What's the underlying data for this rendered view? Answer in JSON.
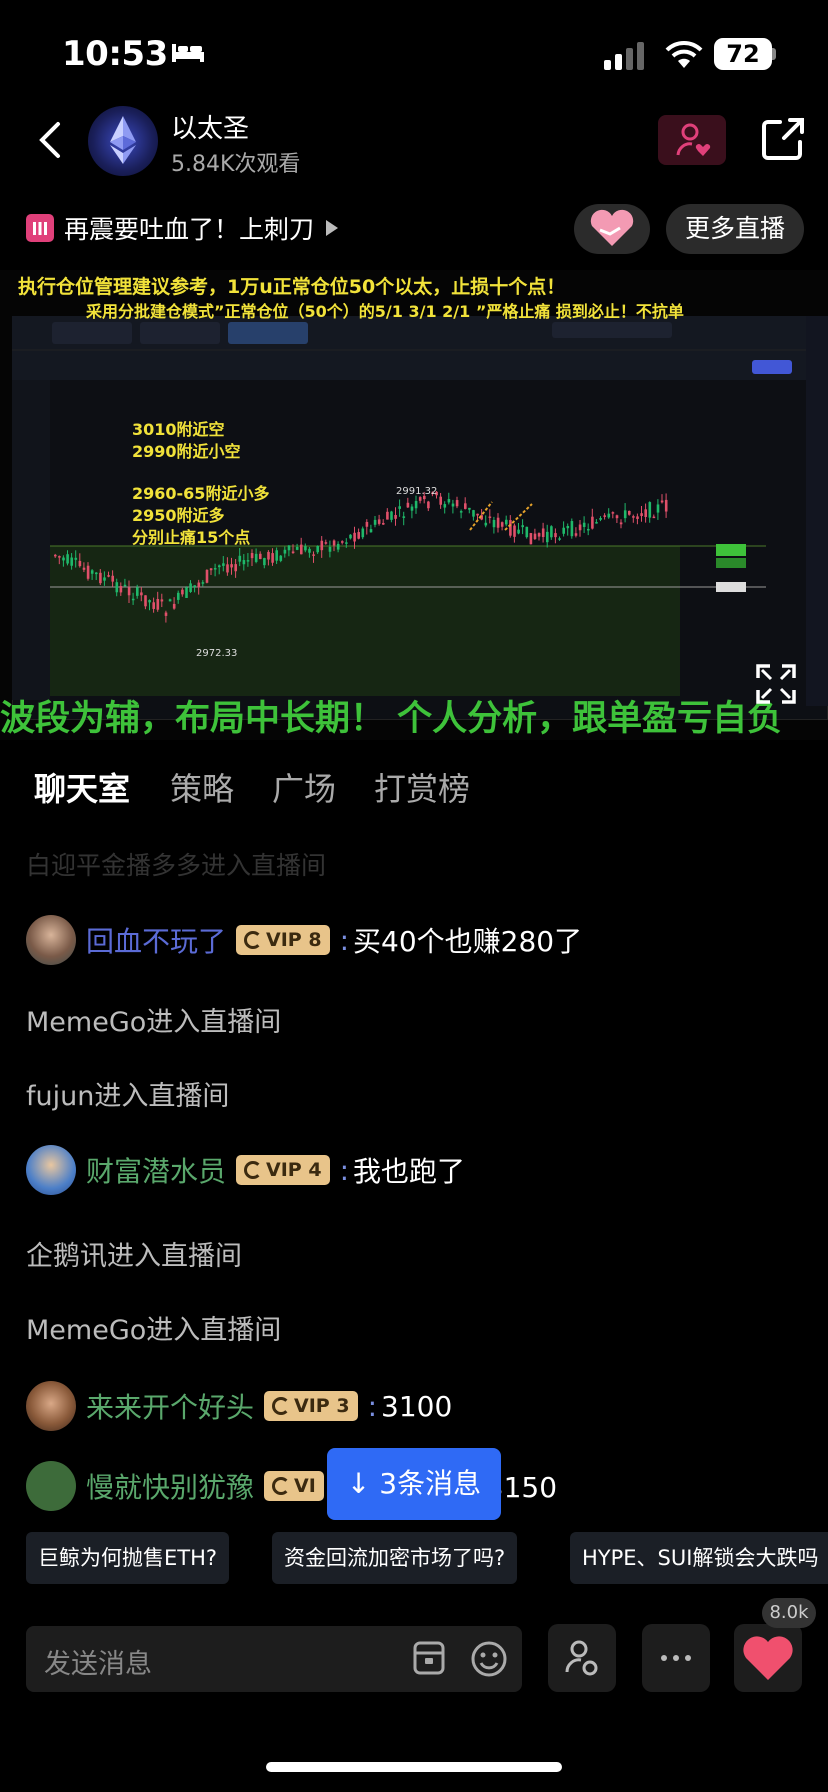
{
  "status": {
    "time": "10:53",
    "battery": "72"
  },
  "header": {
    "channel_name": "以太圣",
    "viewers": "5.84K次观看"
  },
  "topic": {
    "title": "再震要吐血了！上刺刀",
    "more_live": "更多直播"
  },
  "video": {
    "annotation_1": "执行仓位管理建议参考，1万u正常仓位50个以太，止损十个点！",
    "annotation_2": "采用分批建仓模式”正常仓位（50个）的5/1  3/1  2/1 ”严格止痛 损到必止！不抗单",
    "chart_notes": [
      "3010附近空",
      "2990附近小空",
      "2960-65附近小多",
      "2950附近多",
      "分别止痛15个点"
    ],
    "high_label": "2991.32",
    "low_label": "2972.33",
    "ticker": "波段为辅，布局中长期！  个人分析，跟单盈亏自负"
  },
  "tabs": [
    "聊天室",
    "策略",
    "广场",
    "打赏榜"
  ],
  "chat": {
    "faded": "白迎平金播多多进入直播间",
    "messages": [
      {
        "name": "回血不玩了",
        "vip": "VIP 8",
        "text": "买40个也赚280了",
        "name_color": "#5b6bd6"
      },
      {
        "system": "MemeGo进入直播间"
      },
      {
        "system": "fujun进入直播间"
      },
      {
        "name": "财富潜水员",
        "vip": "VIP 4",
        "text": "我也跑了",
        "name_color": "#5aa86c"
      },
      {
        "system": "企鹅讯进入直播间"
      },
      {
        "system": "MemeGo进入直播间"
      },
      {
        "name": "来来开个好头",
        "vip": "VIP 3",
        "text": "3100",
        "name_color": "#5aa86c"
      },
      {
        "name": "慢就快别犹豫",
        "vip": "VI",
        "text": "猜3150",
        "name_color": "#5aa86c"
      }
    ]
  },
  "new_messages": "↓ 3条消息",
  "suggestions": [
    "巨鲸为何抛售ETH?",
    "资金回流加密市场了吗?",
    "HYPE、SUI解锁会大跌吗"
  ],
  "input": {
    "placeholder": "发送消息"
  },
  "likes": "8.0k",
  "colors": {
    "accent": "#2f6af5",
    "ticker": "#3ec23a",
    "annotation": "#f1e23a"
  }
}
